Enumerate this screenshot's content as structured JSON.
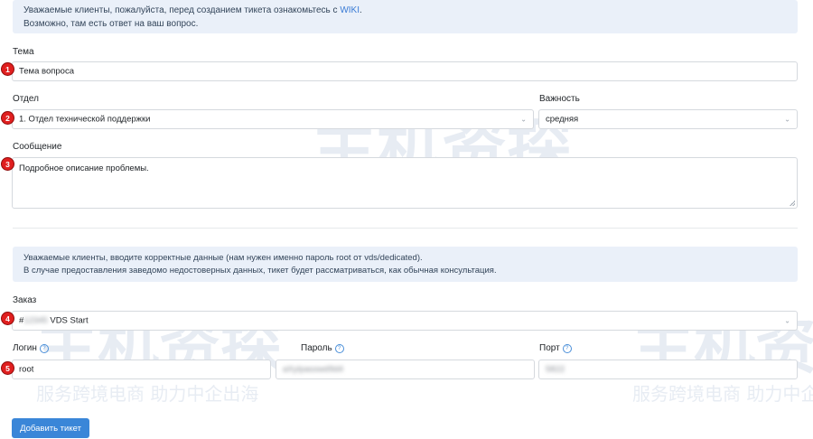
{
  "notice_top": {
    "line1_prefix": "Уважаемые клиенты, пожалуйста, перед созданием тикета ознакомьтесь с",
    "wiki_link": "WIKI",
    "line1_suffix": ".",
    "line2": "Возможно, там есть ответ на ваш вопрос."
  },
  "form": {
    "subject_label": "Тема",
    "subject_value": "Тема вопроса",
    "department_label": "Отдел",
    "department_value": "1. Отдел технической поддержки",
    "priority_label": "Важность",
    "priority_value": "средняя",
    "message_label": "Сообщение",
    "message_value": "Подробное описание проблемы."
  },
  "notice_bottom": {
    "line1": "Уважаемые клиенты, вводите корректные данные (нам нужен именно пароль root от vds/dedicated).",
    "line2": "В случае предоставления заведомо недостоверных данных, тикет будет рассматриваться, как обычная консультация."
  },
  "order": {
    "label": "Заказ",
    "value_prefix": "#",
    "value_hidden": "12345",
    "value_suffix": "VDS Start"
  },
  "credentials": {
    "login_label": "Логин",
    "login_value": "root",
    "password_label": "Пароль",
    "password_value": "aXyIpasswd9d4",
    "port_label": "Порт",
    "port_value": "5822"
  },
  "submit_label": "Добавить тикет",
  "badges": [
    "1",
    "2",
    "3",
    "4",
    "5"
  ],
  "watermark": {
    "big": "主机资探",
    "small": "服务跨境电商 助力中企出海"
  }
}
